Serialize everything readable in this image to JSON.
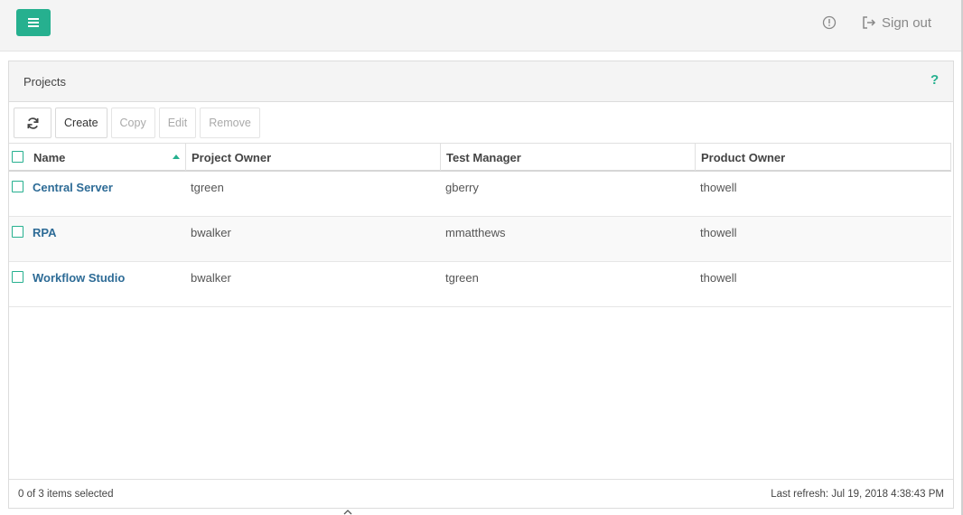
{
  "topbar": {
    "menu_icon": "hamburger-icon",
    "info_icon": "info-circle-icon",
    "signout_icon": "sign-out-icon",
    "signout_label": "Sign out",
    "accent_color": "#26b08f"
  },
  "panel": {
    "title": "Projects",
    "help_label": "?"
  },
  "toolbar": {
    "refresh_icon": "refresh-icon",
    "create_label": "Create",
    "copy_label": "Copy",
    "edit_label": "Edit",
    "remove_label": "Remove"
  },
  "table": {
    "columns": [
      "Name",
      "Project Owner",
      "Test Manager",
      "Product Owner"
    ],
    "sort": {
      "column": "Name",
      "direction": "ascending"
    },
    "rows": [
      {
        "name": "Central Server",
        "project_owner": "tgreen",
        "test_manager": "gberry",
        "product_owner": "thowell"
      },
      {
        "name": "RPA",
        "project_owner": "bwalker",
        "test_manager": "mmatthews",
        "product_owner": "thowell"
      },
      {
        "name": "Workflow Studio",
        "project_owner": "bwalker",
        "test_manager": "tgreen",
        "product_owner": "thowell"
      }
    ]
  },
  "footer": {
    "selection": "0 of 3 items selected",
    "last_refresh": "Last refresh: Jul 19, 2018 4:38:43 PM"
  }
}
